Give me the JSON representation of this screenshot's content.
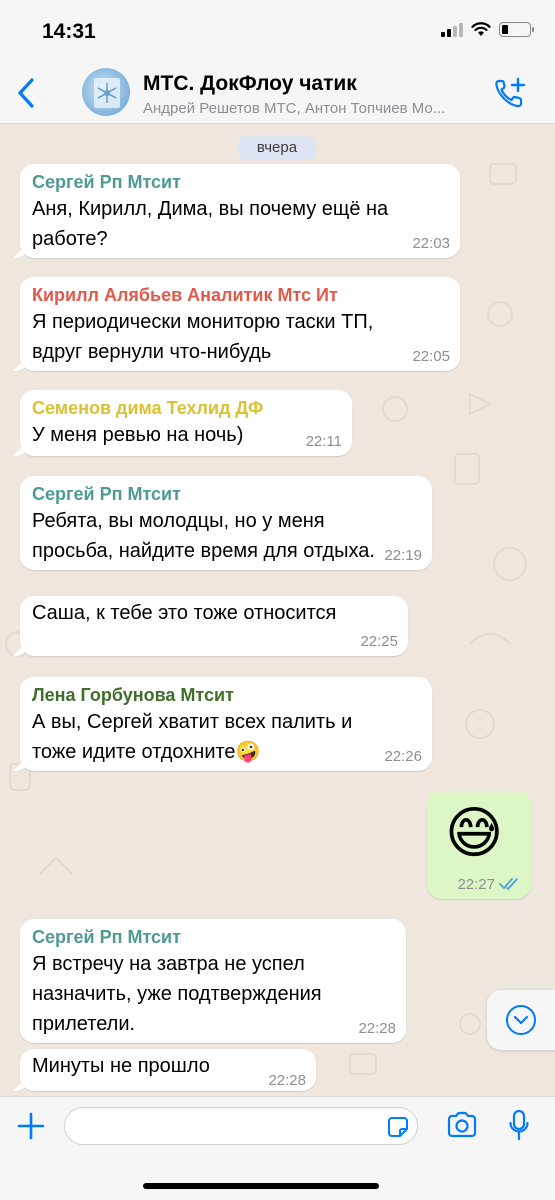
{
  "status_bar": {
    "time": "14:31"
  },
  "header": {
    "title": "МТС. ДокФлоу чатик",
    "subtitle": "Андрей Решетов МТС, Антон Топчиев Мо...",
    "accent": "#007aff"
  },
  "chat": {
    "date_label": "вчера",
    "messages": [
      {
        "sender": "Сергей Рп Мтсит",
        "sender_color": "#4f9a94",
        "lines": [
          "Аня, Кирилл, Дима, вы почему ещё на",
          "работе?"
        ],
        "time": "22:03"
      },
      {
        "sender": "Кирилл Алябьев Аналитик Мтс Ит",
        "sender_color": "#e0594b",
        "lines": [
          "Я периодически мониторю таски ТП,",
          "вдруг вернули что-нибудь"
        ],
        "time": "22:05"
      },
      {
        "sender": "Семенов дима Техлид ДФ",
        "sender_color": "#d9c233",
        "lines": [
          "У меня ревью на ночь)"
        ],
        "time": "22:11"
      },
      {
        "sender": "Сергей Рп Мтсит",
        "sender_color": "#4f9a94",
        "lines": [
          "Ребята, вы молодцы, но у меня",
          "просьба, найдите время для отдыха."
        ],
        "time": "22:19"
      },
      {
        "sender": "",
        "lines": [
          "Саша, к тебе это тоже относится"
        ],
        "time": "22:25"
      },
      {
        "sender": "Лена Горбунова Мтсит",
        "sender_color": "#3f6e2a",
        "lines": [
          "А вы, Сергей хватит всех палить и",
          "тоже идите отдохните🤪"
        ],
        "time": "22:26"
      },
      {
        "sender": "",
        "lines": [
          "😅"
        ],
        "time": "22:27",
        "outgoing": true
      },
      {
        "sender": "Сергей Рп Мтсит",
        "sender_color": "#4f9a94",
        "lines": [
          "Я встречу на завтра не успел",
          "назначить, уже подтверждения",
          "прилетели."
        ],
        "time": "22:28"
      },
      {
        "sender": "",
        "lines": [
          "Минуты не прошло"
        ],
        "time": "22:28"
      }
    ]
  },
  "input": {
    "placeholder": ""
  },
  "icons": {
    "back": "chevron-left-icon",
    "call": "phone-plus-icon",
    "plus": "plus-icon",
    "sticker": "sticker-icon",
    "camera": "camera-icon",
    "mic": "microphone-icon",
    "scroll": "chevron-down-circle-icon",
    "read": "double-check-icon"
  }
}
